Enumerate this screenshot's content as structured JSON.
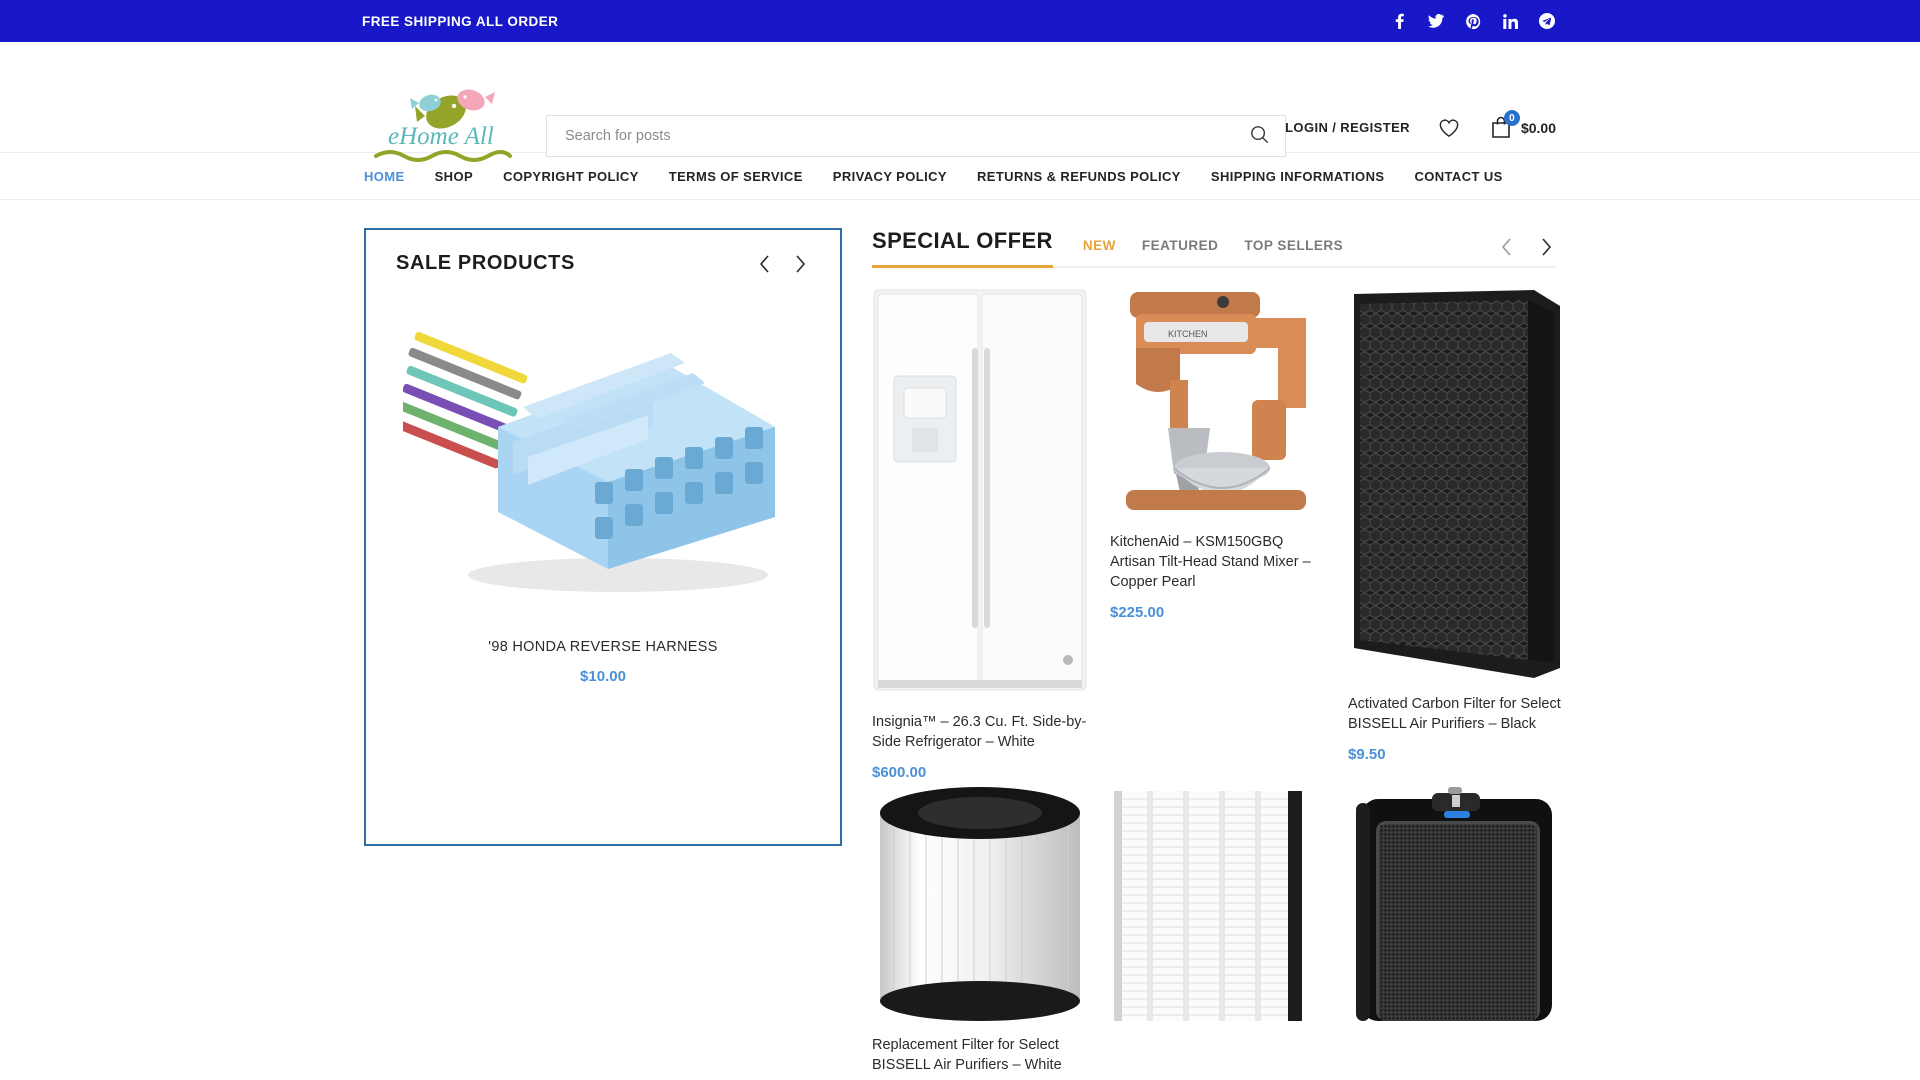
{
  "topbar": {
    "message": "FREE SHIPPING ALL ORDER",
    "socials": [
      {
        "name": "facebook-icon",
        "label": "Facebook"
      },
      {
        "name": "twitter-icon",
        "label": "Twitter"
      },
      {
        "name": "pinterest-icon",
        "label": "Pinterest"
      },
      {
        "name": "linkedin-icon",
        "label": "LinkedIn"
      },
      {
        "name": "telegram-icon",
        "label": "Telegram"
      }
    ],
    "bg_color": "#1818c8"
  },
  "header": {
    "logo_text": "eHome All",
    "search": {
      "placeholder": "Search for posts",
      "value": "",
      "icon": "search-icon"
    },
    "account_label": "LOGIN / REGISTER",
    "wishlist_icon": "heart-icon",
    "cart": {
      "icon": "shopping-bag-icon",
      "count": "0",
      "total": "$0.00",
      "badge_color": "#2b71c9"
    }
  },
  "nav": {
    "items": [
      {
        "label": "HOME",
        "active": true
      },
      {
        "label": "SHOP",
        "active": false
      },
      {
        "label": "COPYRIGHT POLICY",
        "active": false
      },
      {
        "label": "TERMS OF SERVICE",
        "active": false
      },
      {
        "label": "PRIVACY POLICY",
        "active": false
      },
      {
        "label": "RETURNS & REFUNDS POLICY",
        "active": false
      },
      {
        "label": "SHIPPING INFORMATIONS",
        "active": false
      },
      {
        "label": "CONTACT US",
        "active": false
      }
    ],
    "active_color": "#4a90d9"
  },
  "sale_panel": {
    "title": "SALE PRODUCTS",
    "prev_icon": "chevron-left-icon",
    "next_icon": "chevron-right-icon",
    "border_color": "#2f6ea5",
    "product": {
      "name": "'98 HONDA REVERSE HARNESS",
      "price": "$10.00",
      "image_alt": "light-blue automotive wire harness connector with multicolored wires"
    }
  },
  "special_offer": {
    "title": "SPECIAL OFFER",
    "accent_color": "#e8a33d",
    "tabs": [
      {
        "label": "NEW",
        "active": true
      },
      {
        "label": "FEATURED",
        "active": false
      },
      {
        "label": "TOP SELLERS",
        "active": false
      }
    ],
    "prev_icon": "chevron-left-icon",
    "next_icon": "chevron-right-icon",
    "products": [
      {
        "name": "Insignia™ – 26.3 Cu. Ft. Side-by-Side Refrigerator – White",
        "price": "$600.00",
        "image_alt": "white side-by-side refrigerator with water dispenser"
      },
      {
        "name": "KitchenAid – KSM150GBQ Artisan Tilt-Head Stand Mixer – Copper Pearl",
        "price": "$225.00",
        "image_alt": "copper pearl stand mixer with stainless bowl"
      },
      {
        "name": "Activated Carbon Filter for Select BISSELL Air Purifiers – Black",
        "price": "$9.50",
        "image_alt": "black honeycomb activated carbon filter panel"
      },
      {
        "name": "Replacement Filter for Select BISSELL Air Purifiers – White",
        "price": "",
        "image_alt": "cylindrical white pleated HEPA filter with black caps"
      },
      {
        "name": "",
        "price": "",
        "image_alt": "white pleated flat HEPA filter panel"
      },
      {
        "name": "",
        "price": "",
        "image_alt": "black tower air purifier with blue LED indicator"
      }
    ]
  }
}
